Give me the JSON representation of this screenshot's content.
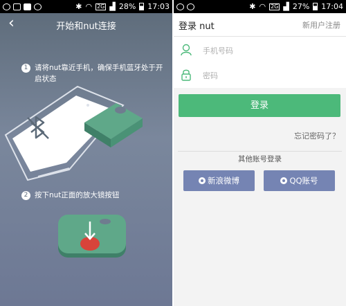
{
  "left_screen": {
    "status_bar": {
      "signal_label": "2G",
      "battery": "28%",
      "time": "17:03"
    },
    "header": {
      "title": "开始和nut连接"
    },
    "steps": [
      {
        "number": "1",
        "line1": "请将nut靠近手机，确保手机蓝牙处于开",
        "line2": "启状态"
      },
      {
        "number": "2",
        "line1": "按下nut正面的放大镜按钮"
      }
    ]
  },
  "right_screen": {
    "status_bar": {
      "signal_label": "2G",
      "battery": "27%",
      "time": "17:04"
    },
    "header": {
      "title": "登录 nut",
      "register": "新用户注册"
    },
    "phone_field": {
      "placeholder": "手机号码"
    },
    "password_field": {
      "placeholder": "密码"
    },
    "login_button": "登录",
    "forgot_password": "忘记密码了？",
    "other_accounts_label": "其他账号登录",
    "social": [
      {
        "label": "新浪微博",
        "icon": "weibo-icon"
      },
      {
        "label": "QQ账号",
        "icon": "qq-icon"
      }
    ],
    "colors": {
      "accent": "#4cb97a",
      "social": "#7584b3"
    }
  }
}
